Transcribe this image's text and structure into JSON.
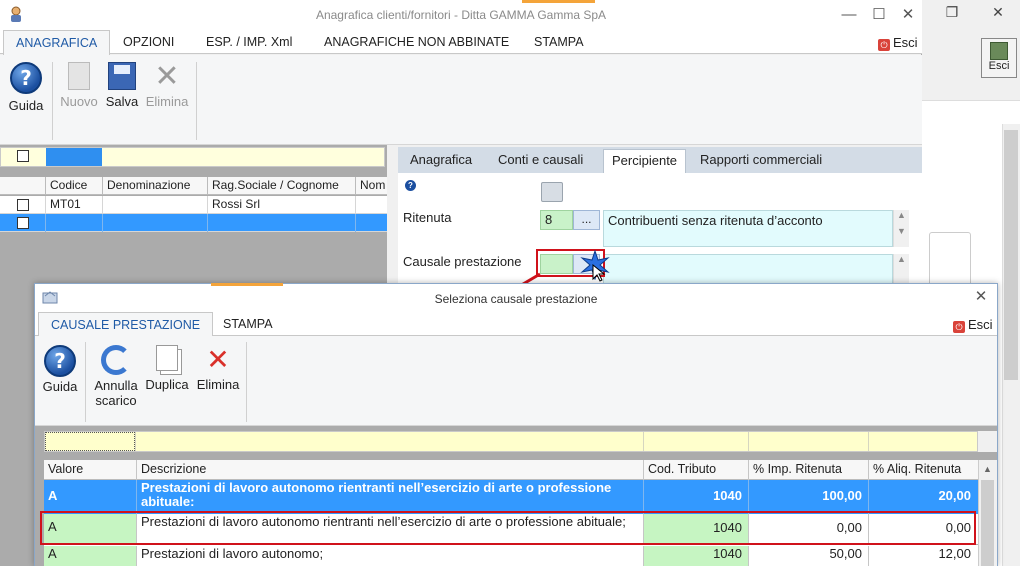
{
  "background_window": {
    "exit_label": "Esci"
  },
  "main_window": {
    "title": "Anagrafica clienti/fornitori - Ditta GAMMA Gamma SpA",
    "tabs": [
      "ANAGRAFICA",
      "OPZIONI",
      "ESP. / IMP. Xml",
      "ANAGRAFICHE NON ABBINATE",
      "STAMPA"
    ],
    "exit_label": "Esci",
    "toolbar": {
      "guida": "Guida",
      "nuovo": "Nuovo",
      "salva": "Salva",
      "elimina": "Elimina"
    },
    "grid": {
      "columns": [
        "Codice",
        "Denominazione",
        "Rag.Sociale / Cognome",
        "Nom"
      ],
      "rows": [
        {
          "codice": "MT01",
          "denominazione": "",
          "ragione": "Rossi Srl",
          "nome": ""
        },
        {
          "codice": "",
          "denominazione": "",
          "ragione": "",
          "nome": ""
        }
      ]
    },
    "detail": {
      "tabs": [
        "Anagrafica",
        "Conti e causali",
        "Percipiente",
        "Rapporti commerciali"
      ],
      "ritenuta_label": "Ritenuta",
      "ritenuta_code": "8",
      "ritenuta_button": "...",
      "ritenuta_description": "Contribuenti senza ritenuta d’acconto",
      "causale_label": "Causale prestazione",
      "causale_code": "",
      "causale_description": ""
    }
  },
  "dialog": {
    "title": "Seleziona causale prestazione",
    "tabs": [
      "CAUSALE PRESTAZIONE",
      "STAMPA"
    ],
    "exit_label": "Esci",
    "toolbar": {
      "guida": "Guida",
      "annulla_line1": "Annulla",
      "annulla_line2": "scarico",
      "duplica": "Duplica",
      "elimina": "Elimina"
    },
    "grid": {
      "columns": [
        "Valore",
        "Descrizione",
        "Cod. Tributo",
        "% Imp. Ritenuta",
        "% Aliq. Ritenuta"
      ],
      "rows": [
        {
          "valore": "A",
          "descrizione": "Prestazioni di lavoro autonomo rientranti nell’esercizio di arte o professione abituale:",
          "cod_tributo": "1040",
          "imp_ritenuta": "100,00",
          "aliq_ritenuta": "20,00"
        },
        {
          "valore": "A",
          "descrizione": "Prestazioni di lavoro autonomo rientranti nell’esercizio di arte o professione abituale;",
          "cod_tributo": "1040",
          "imp_ritenuta": "0,00",
          "aliq_ritenuta": "0,00"
        },
        {
          "valore": "A",
          "descrizione": "Prestazioni di lavoro autonomo;",
          "cod_tributo": "1040",
          "imp_ritenuta": "50,00",
          "aliq_ritenuta": "12,00"
        }
      ]
    }
  },
  "colors": {
    "selected_row": "#3399ff",
    "highlight_row": "#c6f5c2",
    "annotation_red": "#d0121b",
    "ribbon_active_tab": "#1f5aa6",
    "accent_orange": "#f4a43a"
  }
}
